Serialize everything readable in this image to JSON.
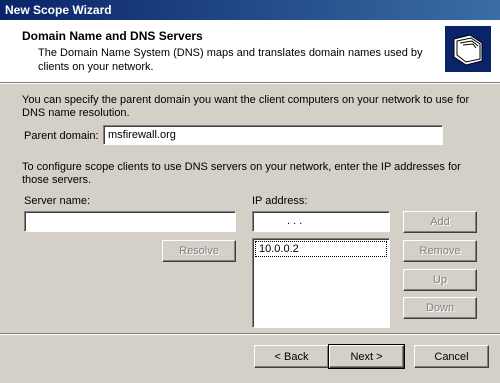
{
  "window": {
    "title": "New Scope Wizard"
  },
  "header": {
    "title": "Domain Name and DNS Servers",
    "description": "The Domain Name System (DNS) maps and translates domain names used by clients on your network."
  },
  "intro_text": "You can specify the parent domain you want the client computers on your network to use for DNS name resolution.",
  "parent_domain": {
    "label": "Parent domain:",
    "value": "msfirewall.org"
  },
  "dns_text": "To configure scope clients to use DNS servers on your network, enter the IP addresses for those servers.",
  "server_name": {
    "label": "Server name:",
    "value": ""
  },
  "ip_address": {
    "label": "IP address:",
    "dots": ".   .   ."
  },
  "ip_list": [
    "10.0.0.2"
  ],
  "buttons": {
    "resolve": "Resolve",
    "add": "Add",
    "remove": "Remove",
    "up": "Up",
    "down": "Down",
    "back": "< Back",
    "next": "Next >",
    "cancel": "Cancel"
  },
  "colors": {
    "titlebar_start": "#0a246a",
    "titlebar_end": "#3a6ea5",
    "dialog_bg": "#d4d0c8"
  },
  "icons": {
    "header_icon": "folders-wizard-icon"
  }
}
